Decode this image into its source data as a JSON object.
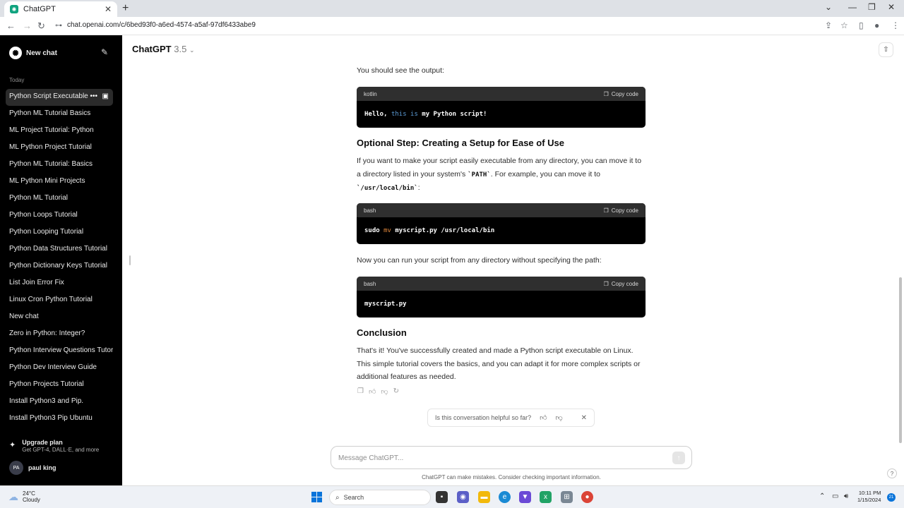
{
  "browser": {
    "tab_title": "ChatGPT",
    "url": "chat.openai.com/c/6bed93f0-a6ed-4574-a5af-97df6433abe9"
  },
  "sidebar": {
    "new_chat": "New chat",
    "section": "Today",
    "items": [
      "Python Script Executable",
      "Python ML Tutorial Basics",
      "ML Project Tutorial: Python",
      "ML Python Project Tutorial",
      "Python ML Tutorial: Basics",
      "ML Python Mini Projects",
      "Python ML Tutorial",
      "Python Loops Tutorial",
      "Python Looping Tutorial",
      "Python Data Structures Tutorial",
      "Python Dictionary Keys Tutorial",
      "List Join Error Fix",
      "Linux Cron Python Tutorial",
      "New chat",
      "Zero in Python: Integer?",
      "Python Interview Questions Tutorial",
      "Python Dev Interview Guide",
      "Python Projects Tutorial",
      "Install Python3 and Pip.",
      "Install Python3 Pip Ubuntu"
    ],
    "upgrade_title": "Upgrade plan",
    "upgrade_sub": "Get GPT-4, DALL·E, and more",
    "user_initials": "PA",
    "user_name": "paul king"
  },
  "header": {
    "model": "ChatGPT",
    "version": "3.5"
  },
  "message": {
    "intro": "You should see the output:",
    "code1": {
      "lang": "kotlin",
      "copy": "Copy code",
      "pre": "Hello, ",
      "kw": "this is",
      "post": " my Python script!"
    },
    "heading1": "Optional Step: Creating a Setup for Ease of Use",
    "para1_a": "If you want to make your script easily executable from any directory, you can move it to a directory listed in your system's ",
    "para1_code1": "`PATH`",
    "para1_b": ". For example, you can move it to ",
    "para1_code2": "`/usr/local/bin`",
    "para1_c": ":",
    "code2": {
      "lang": "bash",
      "copy": "Copy code",
      "pre": "sudo ",
      "kw": "mv",
      "post": " myscript.py /usr/local/bin"
    },
    "para2": "Now you can run your script from any directory without specifying the path:",
    "code3": {
      "lang": "bash",
      "copy": "Copy code",
      "text": "myscript.py"
    },
    "heading2": "Conclusion",
    "para3": "That's it! You've successfully created and made a Python script executable on Linux. This simple tutorial covers the basics, and you can adapt it for more complex scripts or additional features as needed."
  },
  "feedback": {
    "question": "Is this conversation helpful so far?"
  },
  "composer": {
    "placeholder": "Message ChatGPT...",
    "disclaimer": "ChatGPT can make mistakes. Consider checking important information."
  },
  "taskbar": {
    "temp": "24°C",
    "weather": "Cloudy",
    "search": "Search",
    "time": "10:11 PM",
    "date": "1/15/2024",
    "notifications": "21"
  }
}
